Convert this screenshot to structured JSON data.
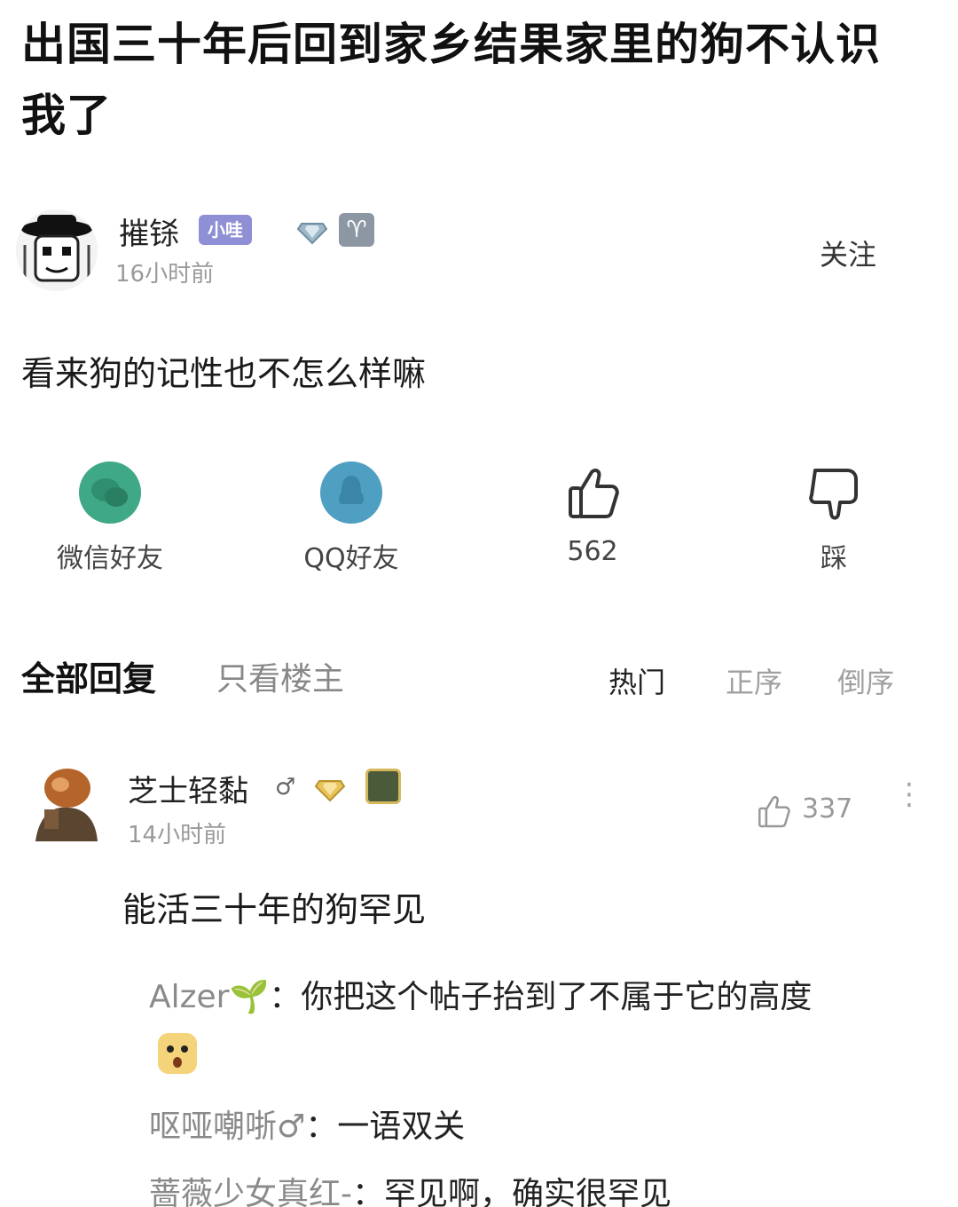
{
  "post": {
    "title": "出国三十年后回到家乡结果家里的狗不认识我了",
    "author": "摧铩",
    "level_badge": "小哇",
    "zodiac_symbol": "♈",
    "time": "16小时前",
    "follow_label": "关注",
    "body": "看来狗的记性也不怎么样嘛"
  },
  "actions": {
    "wechat_label": "微信好友",
    "qq_label": "QQ好友",
    "likes": "562",
    "dislike_label": "踩"
  },
  "reply_tabs": {
    "all": "全部回复",
    "op_only": "只看楼主",
    "sort_hot": "热门",
    "sort_asc": "正序",
    "sort_desc": "倒序"
  },
  "comment": {
    "user": "芝士轻黏",
    "gender_symbol": "♂",
    "time": "14小时前",
    "likes": "337",
    "more_icon": "⋮",
    "body": "能活三十年的狗罕见"
  },
  "subreplies": [
    {
      "user": "Alzer🌱",
      "sep": "：",
      "text": "你把这个帖子抬到了不属于它的高度"
    },
    {
      "user": "呕哑嘲哳♂",
      "sep": "：",
      "text": "一语双关"
    },
    {
      "user": "蔷薇少女真红-",
      "sep": "：",
      "text": "罕见啊，确实很罕见"
    }
  ],
  "colors": {
    "wechat": "#3fa886",
    "qq": "#4f9fc2",
    "level_badge": "#8f8fd6"
  }
}
